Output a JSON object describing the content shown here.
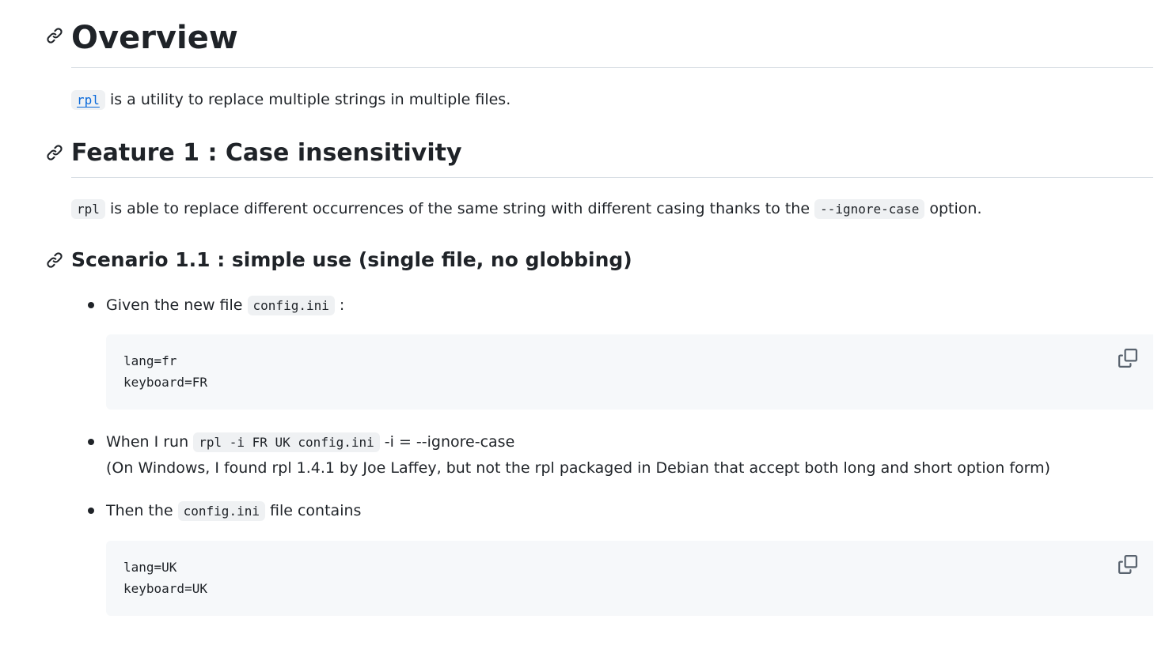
{
  "overview": {
    "title": "Overview",
    "intro_link": "rpl",
    "intro_text": " is a utility to replace multiple strings in multiple files."
  },
  "feature1": {
    "title": "Feature 1 : Case insensitivity",
    "code_rpl": "rpl",
    "text_before": " is able to replace different occurrences of the same string with different casing thanks to the ",
    "code_option": "--ignore-case",
    "text_after": " option."
  },
  "scenario": {
    "title": "Scenario 1.1 : simple use (single file, no globbing)",
    "step1": {
      "text_before": "Given the new file ",
      "code": "config.ini",
      "text_after": " :"
    },
    "code_before": "lang=fr\nkeyboard=FR",
    "step2": {
      "text_before": "When I run ",
      "code": "rpl -i FR UK config.ini",
      "text_after": " -i = --ignore-case",
      "note": "(On Windows, I found rpl 1.4.1 by Joe Laffey, but not the rpl packaged in Debian that accept both long and short option form)"
    },
    "step3": {
      "text_before": "Then the ",
      "code": "config.ini",
      "text_after": " file contains"
    },
    "code_after": "lang=UK\nkeyboard=UK"
  },
  "icons": {
    "anchor": "link-icon",
    "copy": "copy-icon"
  },
  "colors": {
    "text": "#1f2328",
    "link": "#0969da",
    "code_bg": "#f6f8fa",
    "inline_code_bg": "#eff1f3",
    "rule": "#d8dee4",
    "icon": "#59636e"
  }
}
